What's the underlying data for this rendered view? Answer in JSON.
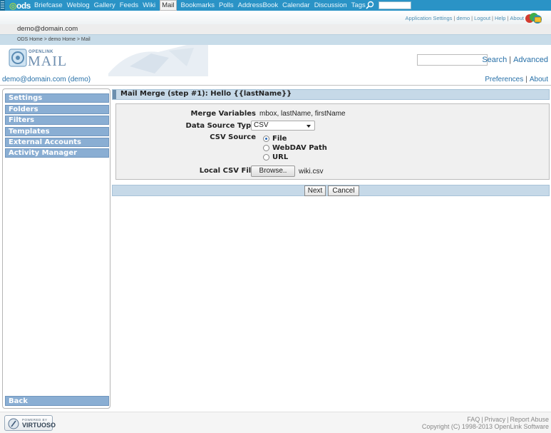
{
  "nav": {
    "logo": "ods",
    "tabs": [
      "Briefcase",
      "Weblog",
      "Gallery",
      "Feeds",
      "Wiki",
      "Mail",
      "Bookmarks",
      "Polls",
      "AddressBook",
      "Calendar",
      "Discussion",
      "Tags"
    ],
    "active_tab": "Mail",
    "search_value": ""
  },
  "appbar": {
    "links": [
      "Application Settings",
      "demo",
      "Logout",
      "Help",
      "About"
    ]
  },
  "user_email": "demo@domain.com",
  "breadcrumb": "ODS Home > demo Home > Mail",
  "banner": {
    "logo_top": "OPENLINK",
    "logo_main": "MAIL",
    "search_value": "",
    "search_link": "Search",
    "advanced_link": "Advanced"
  },
  "userbar": {
    "user": "demo@domain.com (demo)",
    "preferences": "Preferences",
    "about": "About"
  },
  "sidebar": {
    "items": [
      "Settings",
      "Folders",
      "Filters",
      "Templates",
      "External Accounts",
      "Activity Manager"
    ],
    "back": "Back"
  },
  "main": {
    "title": "Mail Merge (step #1): Hello {{lastName}}",
    "fields": {
      "merge_variables_label": "Merge Variables",
      "merge_variables_value": "mbox, lastName, firstName",
      "data_source_label": "Data Source Type",
      "data_source_value": "CSV",
      "csv_source_label": "CSV Source",
      "csv_options": [
        "File",
        "WebDAV Path",
        "URL"
      ],
      "csv_selected": "File",
      "local_csv_label": "Local CSV File",
      "browse_label": "Browse..",
      "file_name": "wiki.csv"
    },
    "buttons": {
      "next": "Next",
      "cancel": "Cancel"
    }
  },
  "footer": {
    "powered_by": "POWERED BY",
    "virtuoso": "VIRTUOSO",
    "links": [
      "FAQ",
      "Privacy",
      "Report Abuse"
    ],
    "copyright": "Copyright (C) 1998-2013 OpenLink Software"
  },
  "colors": {
    "nav_bar": "#2a93c6",
    "sidebar_item": "#8aaed3",
    "header_bar": "#c6d9e8",
    "link": "#2770a8"
  }
}
